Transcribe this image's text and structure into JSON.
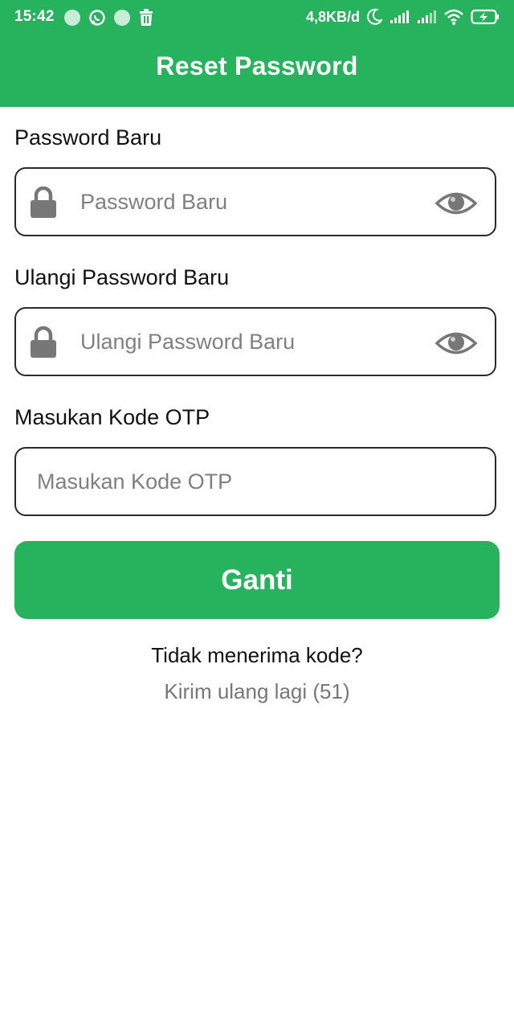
{
  "status_bar": {
    "time": "15:42",
    "net_speed": "4,8KB/d"
  },
  "header": {
    "title": "Reset Password",
    "color": "#27b25d"
  },
  "form": {
    "new_password": {
      "label": "Password Baru",
      "placeholder": "Password Baru",
      "value": ""
    },
    "repeat_password": {
      "label": "Ulangi Password Baru",
      "placeholder": "Ulangi Password Baru",
      "value": ""
    },
    "otp": {
      "label": "Masukan Kode OTP",
      "placeholder": "Masukan Kode OTP",
      "value": ""
    },
    "submit_label": "Ganti"
  },
  "resend": {
    "question": "Tidak menerima kode?",
    "link": "Kirim ulang lagi (51)"
  },
  "icons": {
    "lock": "lock-icon",
    "eye": "eye-icon",
    "trash": "trash-icon",
    "whatsapp": "whatsapp-icon"
  }
}
